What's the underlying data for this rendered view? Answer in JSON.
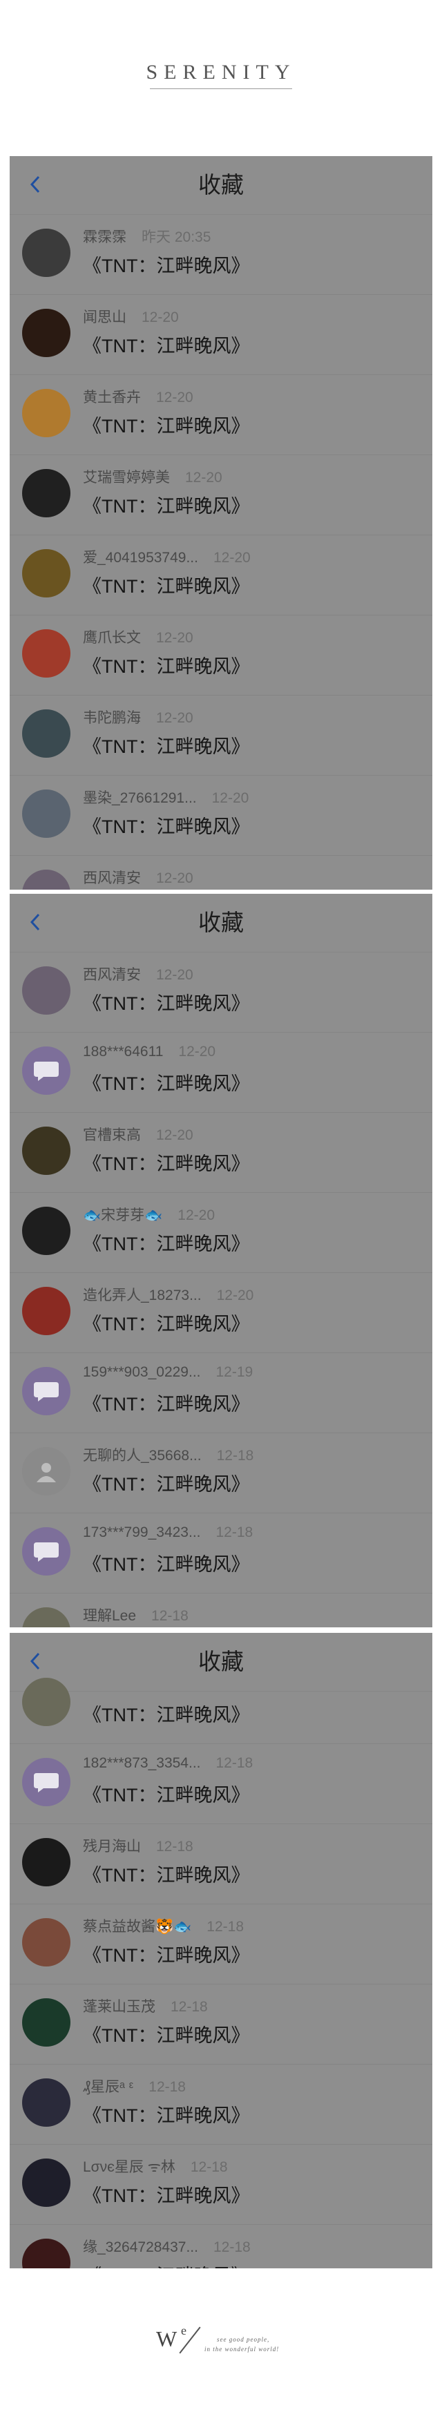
{
  "brand": "SERENITY",
  "footer": {
    "logo_w": "W",
    "logo_e": "e",
    "line1": "see good people,",
    "line2": "in the wonderful world!"
  },
  "panels": [
    {
      "title": "收藏",
      "rows": [
        {
          "name": "霖霂霂",
          "date": "昨天 20:35",
          "work": "《TNT：江畔晚风》",
          "avatar": "#3b3b3b"
        },
        {
          "name": "闻思山",
          "date": "12-20",
          "work": "《TNT：江畔晚风》",
          "avatar": "#2a1a12"
        },
        {
          "name": "黄土香卉",
          "date": "12-20",
          "work": "《TNT：江畔晚风》",
          "avatar": "#b07a2e"
        },
        {
          "name": "艾瑞雪婷婷美",
          "date": "12-20",
          "work": "《TNT：江畔晚风》",
          "avatar": "#202020"
        },
        {
          "name": "爱_4041953749...",
          "date": "12-20",
          "work": "《TNT：江畔晚风》",
          "avatar": "#6a5420"
        },
        {
          "name": "鹰爪长文",
          "date": "12-20",
          "work": "《TNT：江畔晚风》",
          "avatar": "#a03a2a"
        },
        {
          "name": "韦陀鹏海",
          "date": "12-20",
          "work": "《TNT：江畔晚风》",
          "avatar": "#3a4a50"
        },
        {
          "name": "墨染_27661291...",
          "date": "12-20",
          "work": "《TNT：江畔晚风》",
          "avatar": "#5a6470"
        },
        {
          "name": "西风清安",
          "date": "12-20",
          "work": "",
          "avatar": "#6a6070"
        }
      ]
    },
    {
      "title": "收藏",
      "rows": [
        {
          "name": "西风清安",
          "date": "12-20",
          "work": "《TNT：江畔晚风》",
          "avatar": "#6a6070"
        },
        {
          "name": "188***64611",
          "date": "12-20",
          "work": "《TNT：江畔晚风》",
          "avatar": "#7d6f9a"
        },
        {
          "name": "官槽束高",
          "date": "12-20",
          "work": "《TNT：江畔晚风》",
          "avatar": "#3b3420"
        },
        {
          "name": "🐟宋芽芽🐟",
          "date": "12-20",
          "work": "《TNT：江畔晚风》",
          "avatar": "#1e1e1e"
        },
        {
          "name": "造化弄人_18273...",
          "date": "12-20",
          "work": "《TNT：江畔晚风》",
          "avatar": "#8a2a22"
        },
        {
          "name": "159***903_0229...",
          "date": "12-19",
          "work": "《TNT：江畔晚风》",
          "avatar": "#7d6f9a"
        },
        {
          "name": "无聊的人_35668...",
          "date": "12-18",
          "work": "《TNT：江畔晚风》",
          "avatar": "#8a8a8a"
        },
        {
          "name": "173***799_3423...",
          "date": "12-18",
          "work": "《TNT：江畔晚风》",
          "avatar": "#7d6f9a"
        },
        {
          "name": "理解Lee",
          "date": "12-18",
          "work": "",
          "avatar": "#6a6a5a"
        }
      ]
    },
    {
      "title": "收藏",
      "rows": [
        {
          "name": "",
          "date": "",
          "work": "《TNT：江畔晚风》",
          "avatar": "#6a6a5a"
        },
        {
          "name": "182***873_3354...",
          "date": "12-18",
          "work": "《TNT：江畔晚风》",
          "avatar": "#7d6f9a"
        },
        {
          "name": "残月海山",
          "date": "12-18",
          "work": "《TNT：江畔晚风》",
          "avatar": "#1a1a1a"
        },
        {
          "name": "蔡点益故酱🐯🐟",
          "date": "12-18",
          "work": "《TNT：江畔晚风》",
          "avatar": "#7a4a3a"
        },
        {
          "name": "蓬莱山玉茂",
          "date": "12-18",
          "work": "《TNT：江畔晚风》",
          "avatar": "#1a3a2a"
        },
        {
          "name": "₰星辰ᵃ ᵋ",
          "date": "12-18",
          "work": "《TNT：江畔晚风》",
          "avatar": "#2a2a3a"
        },
        {
          "name": "Lσνє星辰 ᯤ林",
          "date": "12-18",
          "work": "《TNT：江畔晚风》",
          "avatar": "#1e1e2a"
        },
        {
          "name": "缘_3264728437...",
          "date": "12-18",
          "work": "《TNT：江畔晚风》",
          "avatar": "#3a1818"
        }
      ]
    }
  ]
}
